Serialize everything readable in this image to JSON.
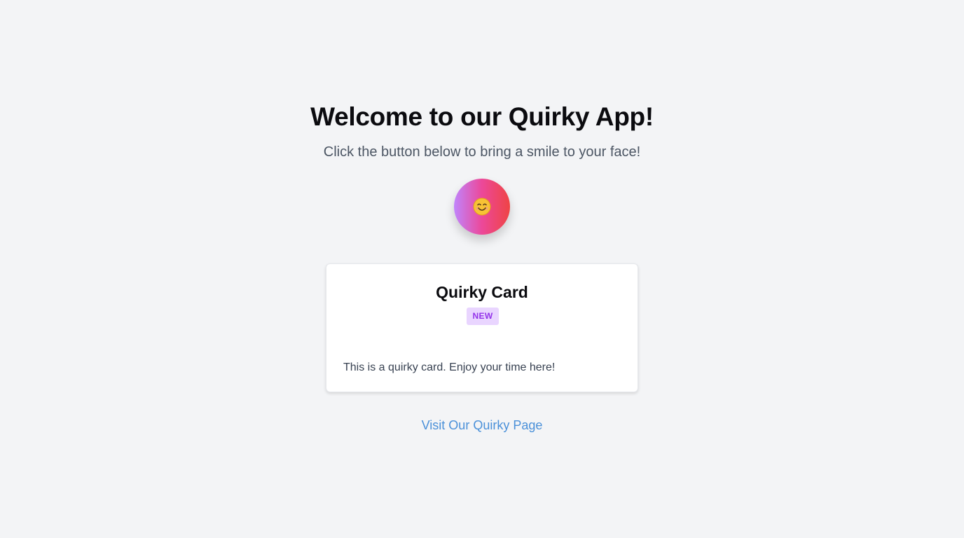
{
  "header": {
    "title": "Welcome to our Quirky App!",
    "subtitle": "Click the button below to bring a smile to your face!"
  },
  "smile_button": {
    "icon": "smiling-face-icon",
    "gradient": [
      "#c084fc",
      "#ec4899",
      "#ef4444"
    ]
  },
  "card": {
    "title": "Quirky Card",
    "badge": "NEW",
    "body": "This is a quirky card. Enjoy your time here!"
  },
  "footer": {
    "link_label": "Visit Our Quirky Page"
  },
  "colors": {
    "background": "#f3f4f6",
    "link": "#4a90d9",
    "badge_bg": "#e9d5ff",
    "badge_text": "#9333ea"
  }
}
